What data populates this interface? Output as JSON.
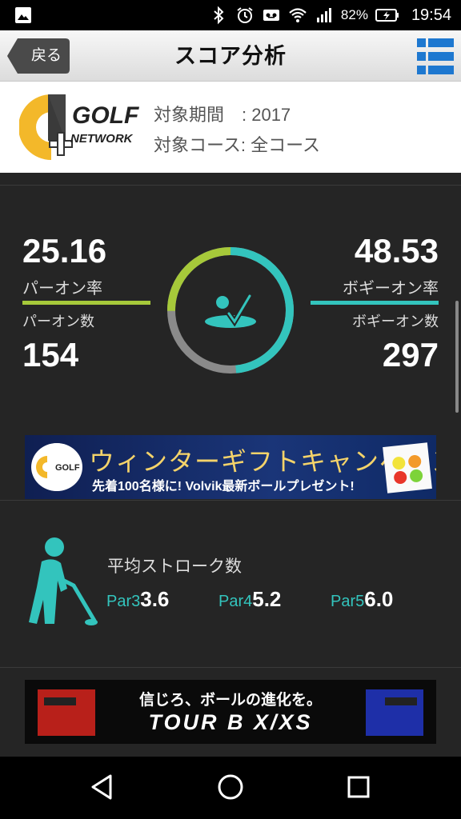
{
  "status_bar": {
    "battery": "82%",
    "time": "19:54",
    "icons": [
      "image-icon",
      "bluetooth-icon",
      "alarm-icon",
      "voicemail-icon",
      "wifi-icon",
      "signal-icon",
      "battery-charging-icon"
    ]
  },
  "header": {
    "back_label": "戻る",
    "title": "スコア分析",
    "menu_icon": "menu-list-icon"
  },
  "info": {
    "logo_text_1": "GOLF",
    "logo_text_2": "NETWORK",
    "period_row": "対象期間　: 2017",
    "course_row": "対象コース: 全コース"
  },
  "stats": {
    "par_on_rate": "25.16",
    "par_on_rate_label": "パーオン率",
    "par_on_count_label": "パーオン数",
    "par_on_count": "154",
    "bogey_on_rate": "48.53",
    "bogey_on_rate_label": "ボギーオン率",
    "bogey_on_count_label": "ボギーオン数",
    "bogey_on_count": "297",
    "colors": {
      "par_on": "#a6c93a",
      "bogey_on": "#33c4bd",
      "rest": "#8a8a8a"
    },
    "par_on_fraction": 0.2516,
    "bogey_on_fraction": 0.4853
  },
  "banner_winter": {
    "title": "ウィンターギフトキャンペーン",
    "subtitle": "先着100名様に! Volvik最新ボールプレゼント!"
  },
  "strokes": {
    "title": "平均ストローク数",
    "par3_label": "Par3",
    "par3_value": "3.6",
    "par4_label": "Par4",
    "par4_value": "5.2",
    "par5_label": "Par5",
    "par5_value": "6.0"
  },
  "banner_tourb": {
    "tagline": "信じろ、ボールの進化を。",
    "product": "TOUR B X/XS"
  },
  "nav": [
    "back-triangle-icon",
    "home-circle-icon",
    "recents-square-icon"
  ]
}
